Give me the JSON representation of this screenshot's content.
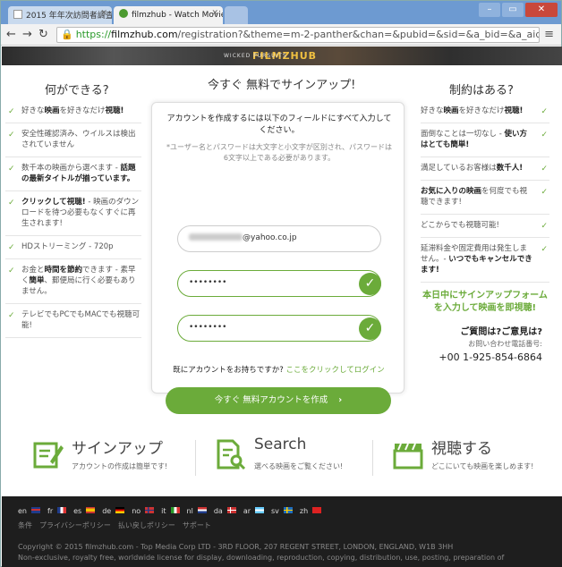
{
  "browser": {
    "tabs": [
      {
        "title": "2015 年年次訪問者調査"
      },
      {
        "title": "filmzhub - Watch Movie"
      }
    ],
    "url_scheme": "https://",
    "url_host": "filmzhub.com",
    "url_path": "/registration?&theme=m-2-panther&chan=&pubid=&sid=&a_bid=&a_aid=62bd8sn"
  },
  "banner": {
    "logo": "FILMZHUB",
    "tagline": "WICKED PURSUITS"
  },
  "left": {
    "title": "何ができる?",
    "items": [
      {
        "pre": "好きな",
        "bold1": "映画",
        "mid": "を好きなだけ",
        "bold2": "視聴!",
        "post": ""
      },
      {
        "pre": "安全性確認済み、ウイルスは検出されていません",
        "bold1": "",
        "mid": "",
        "bold2": "",
        "post": ""
      },
      {
        "pre": "数千本の映画から選べます - ",
        "bold1": "話題の最新タイトルが揃っています。",
        "mid": "",
        "bold2": "",
        "post": ""
      },
      {
        "pre": "",
        "bold1": "クリックして視聴!",
        "mid": " - 映画のダウンロードを待つ必要もなくすぐに再生されます!",
        "bold2": "",
        "post": ""
      },
      {
        "pre": "HDストリーミング - 720p",
        "bold1": "",
        "mid": "",
        "bold2": "",
        "post": ""
      },
      {
        "pre": "お金と",
        "bold1": "時間を節約",
        "mid": "できます - 素早く",
        "bold2": "簡単",
        "post": "、郵便局に行く必要もありません。"
      },
      {
        "pre": "テレビでもPCでもMACでも視聴可能!",
        "bold1": "",
        "mid": "",
        "bold2": "",
        "post": ""
      }
    ]
  },
  "center": {
    "title": "今すぐ 無料でサインアップ!",
    "intro": "アカウントを作成するには以下のフィールドにすべて入力してください。",
    "note": "*ユーザー名とパスワードは大文字と小文字が区別され、パスワードは6文字以上である必要があります。",
    "email_value": "@yahoo.co.jp",
    "password_value": "••••••••",
    "confirm_value": "••••••••",
    "login_prompt": "既にアカウントをお持ちですか?",
    "login_link": "ここをクリックしてログイン",
    "cta": "今すぐ 無料アカウントを作成",
    "cta_arrow": "›"
  },
  "right": {
    "title": "制約はある?",
    "items": [
      {
        "pre": "好きな",
        "bold1": "映画",
        "mid": "を好きなだけ",
        "bold2": "視聴!",
        "post": ""
      },
      {
        "pre": "面倒なことは一切なし - ",
        "bold1": "使い方はとても簡単!",
        "mid": "",
        "bold2": "",
        "post": ""
      },
      {
        "pre": "満足しているお客様は",
        "bold1": "数千人!",
        "mid": "",
        "bold2": "",
        "post": ""
      },
      {
        "pre": "",
        "bold1": "お気に入りの映画",
        "mid": "を何度でも視聴できます!",
        "bold2": "",
        "post": ""
      },
      {
        "pre": "どこからでも視聴可能!",
        "bold1": "",
        "mid": "",
        "bold2": "",
        "post": ""
      },
      {
        "pre": "延滞料金や固定費用は発生しません。- ",
        "bold1": "いつでもキャンセルできます!",
        "mid": "",
        "bold2": "",
        "post": ""
      }
    ],
    "promo": "本日中にサインアップフォームを入力して映画を即視聴!",
    "question": "ご質問は?ご意見は?",
    "phone_label": "お問い合わせ電話番号:",
    "phone": "+00 1-925-854-6864"
  },
  "steps": [
    {
      "title": "サインアップ",
      "sub": "アカウントの作成は簡単です!",
      "icon": "signup-form-icon"
    },
    {
      "title": "Search",
      "sub": "選べる映画をご覧ください!",
      "icon": "search-document-icon"
    },
    {
      "title": "視聴する",
      "sub": "どこにいても映画を楽しめます!",
      "icon": "clapperboard-icon"
    }
  ],
  "footer": {
    "languages": [
      "en",
      "fr",
      "es",
      "de",
      "no",
      "it",
      "nl",
      "da",
      "ar",
      "sv",
      "zh"
    ],
    "links": [
      "条件",
      "プライバシーポリシー",
      "払い戻しポリシー",
      "サポート"
    ],
    "copyright1": "Copyright © 2015 filmzhub.com - Top Media Corp LTD - 3RD FLOOR, 207 REGENT STREET, LONDON, ENGLAND, W1B 3HH",
    "copyright2": "Non-exclusive, royalty free, worldwide license for display, downloading, reproduction, copying, distribution, use, posting, preparation of"
  },
  "colors": {
    "accent": "#6bab3a",
    "footer_bg": "#1e1e1e"
  }
}
